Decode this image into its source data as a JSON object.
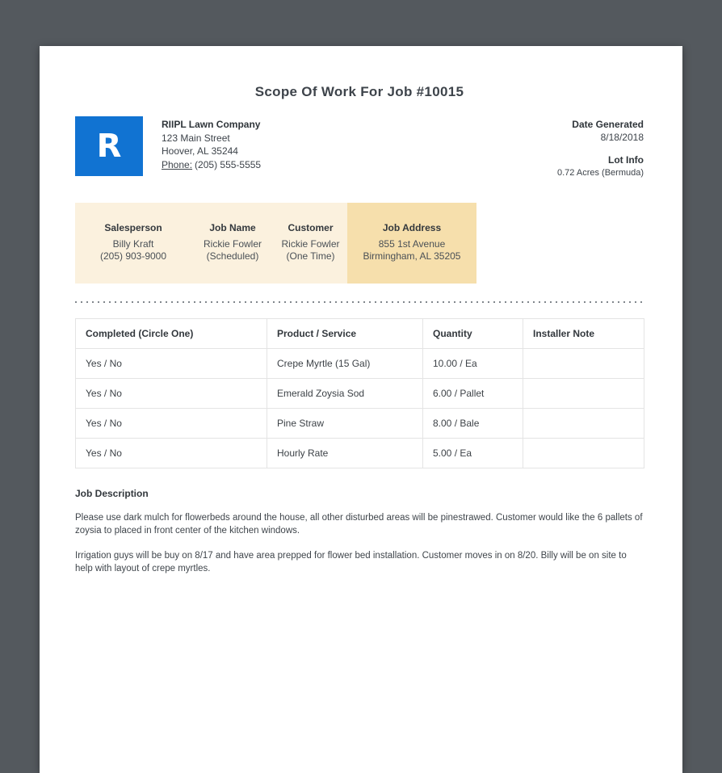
{
  "page": {
    "title": "Scope Of Work For Job #10015"
  },
  "company": {
    "logo_letter": "R",
    "name": "RIIPL Lawn Company",
    "address_line1": "123 Main Street",
    "address_line2": "Hoover, AL 35244",
    "phone_label": "Phone:",
    "phone": "(205) 555-5555"
  },
  "meta": {
    "date_generated_label": "Date Generated",
    "date_generated": "8/18/2018",
    "lot_info_label": "Lot Info",
    "lot_info": "0.72 Acres (Bermuda)"
  },
  "info_bar": {
    "columns": [
      {
        "label": "Salesperson",
        "line1": "Billy Kraft",
        "line2": "(205) 903-9000"
      },
      {
        "label": "Job Name",
        "line1": "Rickie Fowler",
        "line2": "(Scheduled)"
      },
      {
        "label": "Customer",
        "line1": "Rickie Fowler",
        "line2": "(One Time)"
      },
      {
        "label": "Job Address",
        "line1": "855 1st Avenue",
        "line2": "Birmingham, AL 35205"
      }
    ]
  },
  "work_table": {
    "headers": [
      "Completed (Circle One)",
      "Product / Service",
      "Quantity",
      "Installer Note"
    ],
    "rows": [
      [
        "Yes / No",
        "Crepe Myrtle (15 Gal)",
        "10.00 / Ea",
        ""
      ],
      [
        "Yes / No",
        "Emerald Zoysia Sod",
        "6.00 / Pallet",
        ""
      ],
      [
        "Yes / No",
        "Pine Straw",
        "8.00 / Bale",
        ""
      ],
      [
        "Yes / No",
        "Hourly Rate",
        "5.00 / Ea",
        ""
      ]
    ]
  },
  "job_description": {
    "heading": "Job Description",
    "paragraphs": [
      "Please use dark mulch for flowerbeds around the house, all other disturbed areas will be pinestrawed. Customer would like the 6 pallets of zoysia to placed in front center of the kitchen windows.",
      "Irrigation guys will be buy on 8/17 and have area prepped for flower bed installation. Customer moves in on 8/20. Billy will be on site to help with layout of crepe myrtles."
    ]
  },
  "colors": {
    "accent_blue": "#1173d2",
    "summary_bar_bg": "#fbf1de",
    "summary_bar_highlight_bg": "#f6dfac",
    "canvas_bg": "#54595e",
    "page_bg": "#ffffff"
  }
}
